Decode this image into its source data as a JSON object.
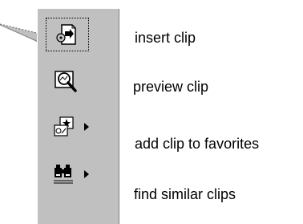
{
  "menu": {
    "items": [
      {
        "label": "insert clip",
        "icon": "insert-clip-icon",
        "has_submenu": false
      },
      {
        "label": "preview clip",
        "icon": "preview-clip-icon",
        "has_submenu": false
      },
      {
        "label": "add clip to favorites",
        "icon": "add-to-favorites-icon",
        "has_submenu": true
      },
      {
        "label": "find similar clips",
        "icon": "find-similar-icon",
        "has_submenu": true
      }
    ]
  },
  "colors": {
    "toolbar": "#c0c0c0",
    "text": "#000000"
  }
}
